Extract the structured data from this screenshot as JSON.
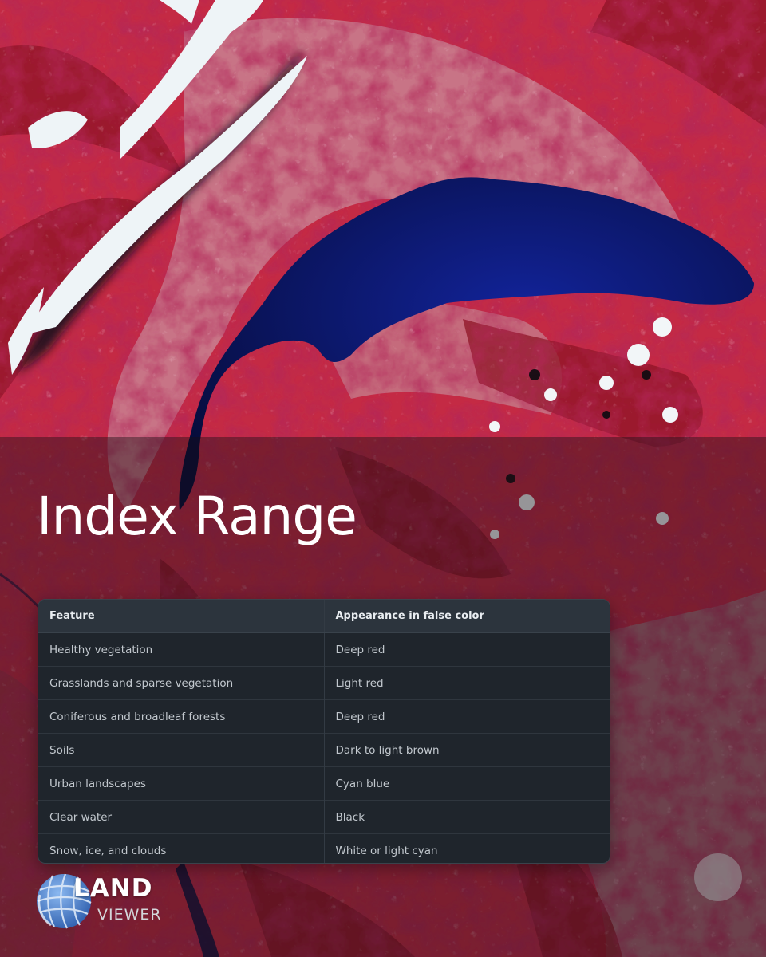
{
  "title": "Index Range",
  "table": {
    "headers": [
      "Feature",
      "Appearance in false color"
    ],
    "rows": [
      [
        "Healthy vegetation",
        "Deep red"
      ],
      [
        "Grasslands and sparse vegetation",
        "Light red"
      ],
      [
        "Coniferous and broadleaf forests",
        "Deep red"
      ],
      [
        "Soils",
        "Dark to light brown"
      ],
      [
        "Urban landscapes",
        "Cyan blue"
      ],
      [
        "Clear water",
        "Black"
      ],
      [
        "Snow, ice, and clouds",
        "White or light cyan"
      ]
    ]
  },
  "logo": {
    "line1": "LAND",
    "line2": "VIEWER",
    "icon": "globe-icon"
  },
  "colors": {
    "vegetation_red": "#c42a44",
    "deep_red": "#8e1426",
    "water_blue": "#0a1457",
    "cloud_white": "#eef4f7",
    "table_bg": "#1f252c",
    "header_bg": "#2c343d",
    "logo_blue": "#4a86d6"
  }
}
